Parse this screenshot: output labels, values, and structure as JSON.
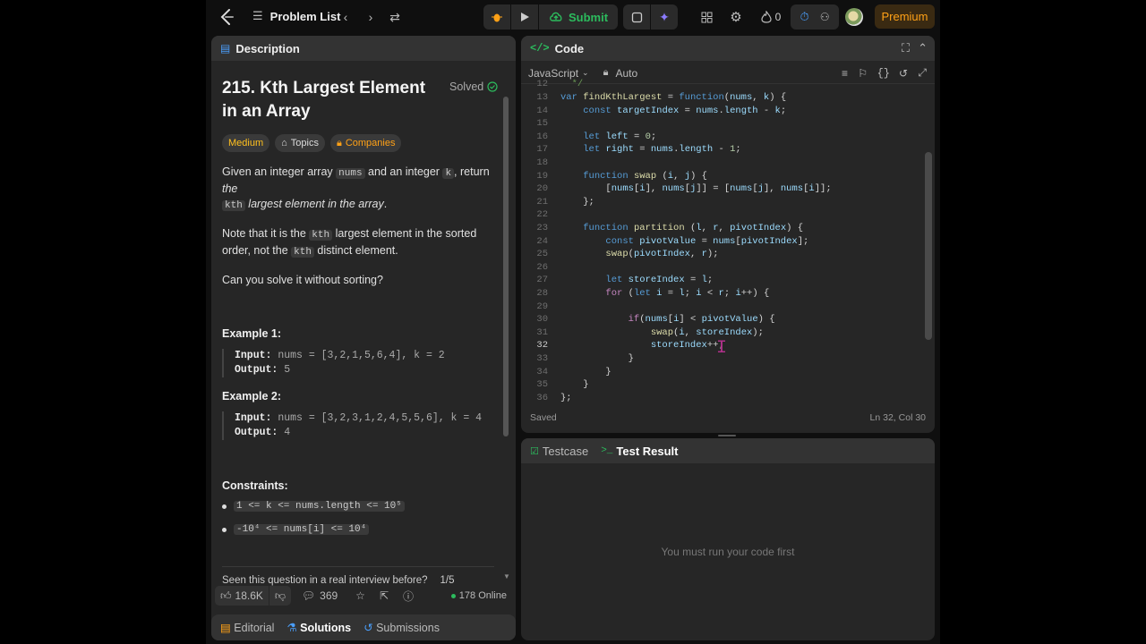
{
  "nav": {
    "problem_list": "Problem List",
    "submit": "Submit",
    "streak": "0",
    "premium": "Premium"
  },
  "description": {
    "tab": "Description",
    "title": "215. Kth Largest Element in an Array",
    "solved": "Solved",
    "tags": [
      "Medium",
      "Topics",
      "Companies"
    ],
    "para1_a": "Given an integer array ",
    "para1_code1": "nums",
    "para1_b": " and an integer ",
    "para1_code2": "k",
    "para1_c": ", return ",
    "para1_d": "the",
    "para1_code3": "kth",
    "para1_e": " largest element in the array",
    "para1_f": ".",
    "para2_a": "Note that it is the ",
    "para2_code1": "kth",
    "para2_b": " largest element in the sorted order, not the ",
    "para2_code2": "kth",
    "para2_c": " distinct element.",
    "para3": "Can you solve it without sorting?",
    "example1_title": "Example 1:",
    "example1_input_label": "Input:",
    "example1_input": " nums = [3,2,1,5,6,4], k = 2",
    "example1_output_label": "Output:",
    "example1_output": " 5",
    "example2_title": "Example 2:",
    "example2_input_label": "Input:",
    "example2_input": " nums = [3,2,3,1,2,4,5,5,6], k = 4",
    "example2_output_label": "Output:",
    "example2_output": " 4",
    "constraints_title": "Constraints:",
    "constraint1": "1 <= k <= nums.length <= 10⁵",
    "constraint2": "-10⁴ <= nums[i] <= 10⁴",
    "seen_text": "Seen this question in a real interview before?",
    "seen_count": "1/5",
    "likes": "18.6K",
    "comments": "369",
    "online": "178 Online"
  },
  "bottom_tabs": [
    "Editorial",
    "Solutions",
    "Submissions"
  ],
  "code": {
    "tab": "Code",
    "language": "JavaScript",
    "mode": "Auto",
    "saved": "Saved",
    "cursor": "Ln 32, Col 30"
  },
  "test": {
    "tabs": [
      "Testcase",
      "Test Result"
    ],
    "empty": "You must run your code first"
  },
  "colors": {
    "accent": "#ffa116",
    "green": "#2cbb5d",
    "medium": "#ffc01e"
  }
}
